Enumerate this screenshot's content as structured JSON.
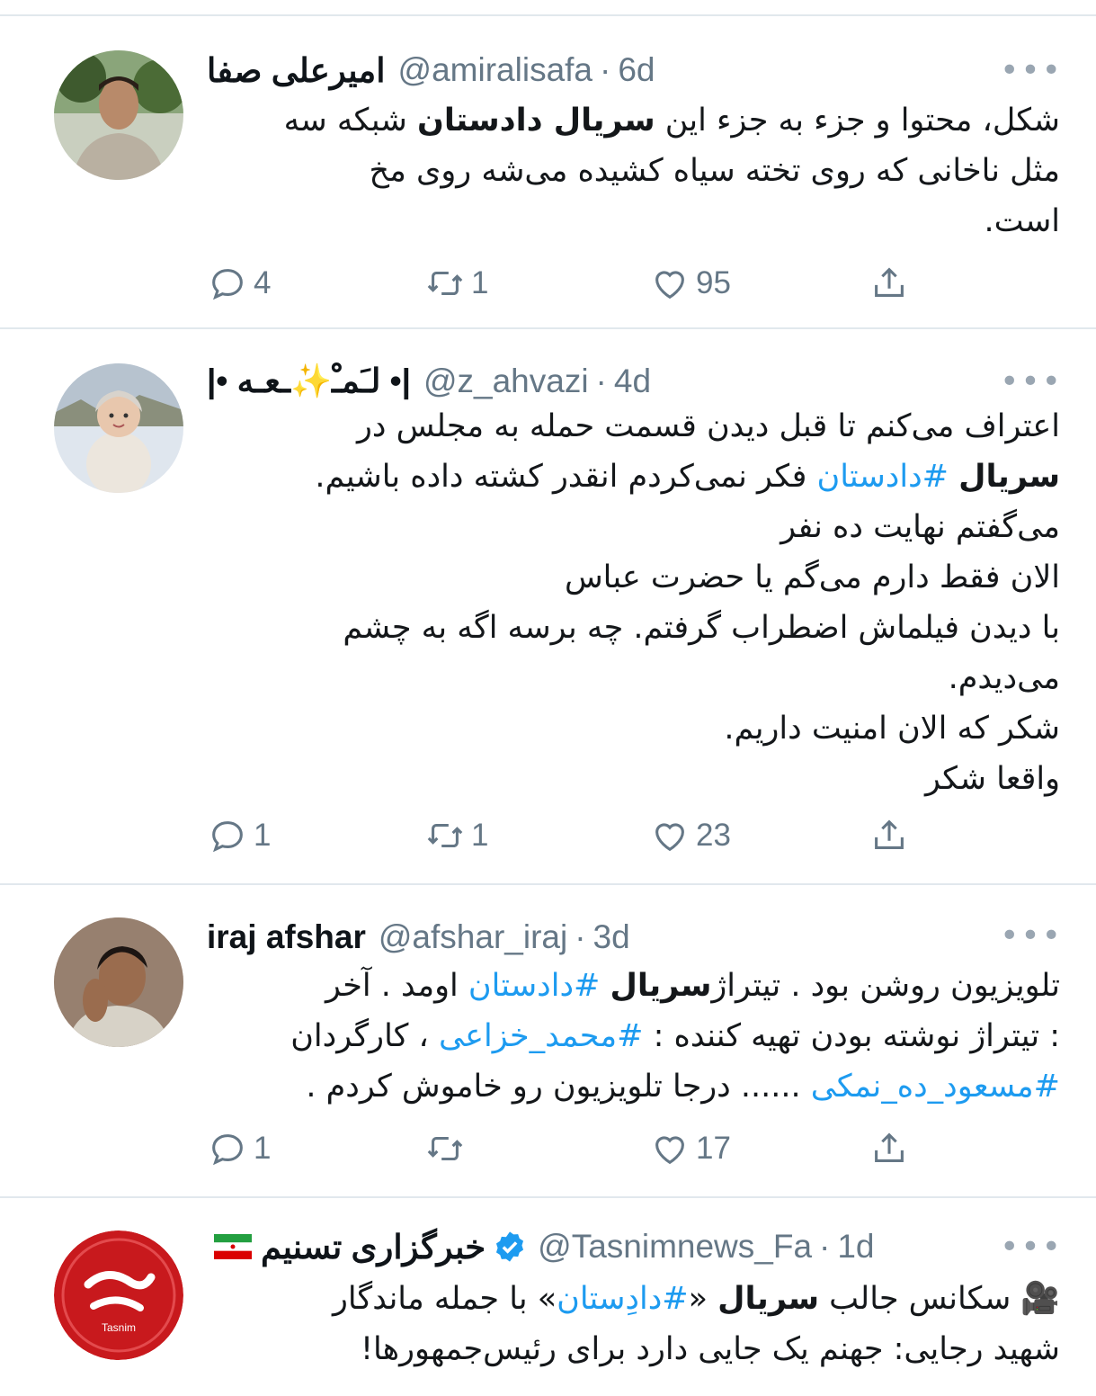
{
  "more_icon": "more-horizontal-icon",
  "colors": {
    "hashtag": "#1d9bf0",
    "meta": "#657786",
    "divider": "#e1e8ed",
    "verified": "#1d9bf0"
  },
  "tweets": [
    {
      "name": "امیرعلی صفا",
      "handle": "@amiralisafa",
      "time": "6d",
      "body_lines": [
        [
          "شکل، محتوا و جزء به جزء این ",
          {
            "b": "سریال دادستان"
          },
          " شبکه سه"
        ],
        [
          "مثل ناخانی که روی تخته سیاه کشیده می‌شه روی مخ"
        ],
        [
          "است."
        ]
      ],
      "replies": "4",
      "retweets": "1",
      "likes": "95"
    },
    {
      "name": "|• لـَمـْ✨ـعـه •|",
      "handle": "@z_ahvazi",
      "time": "4d",
      "body_lines": [
        [
          "اعتراف می‌کنم تا قبل دیدن قسمت حمله به مجلس در"
        ],
        [
          {
            "b": "سریال"
          },
          " ",
          {
            "h": "#دادستان"
          },
          " فکر نمی‌کردم انقدر کشته داده باشیم."
        ],
        [
          "می‌گفتم نهایت ده نفر"
        ],
        [
          "الان فقط دارم می‌گم یا حضرت عباس"
        ],
        [
          "با دیدن فیلماش اضطراب گرفتم. چه برسه اگه به چشم"
        ],
        [
          "می‌دیدم."
        ],
        [
          "شکر که الان امنیت داریم."
        ],
        [
          "واقعا شکر"
        ]
      ],
      "replies": "1",
      "retweets": "1",
      "likes": "23"
    },
    {
      "name": "iraj afshar",
      "handle": "@afshar_iraj",
      "time": "3d",
      "body_lines": [
        [
          "تلویزیون روشن بود . تیتراژ",
          {
            "b": "سریال"
          },
          " ",
          {
            "h": "#دادستان"
          },
          "  اومد . آخر"
        ],
        [
          ": تیتراژ نوشته بودن تهیه کننده : ",
          {
            "h": "#محمد_خزاعی"
          },
          " ، کارگردان"
        ],
        [
          {
            "h": "#مسعود_ده_نمکی"
          },
          " ...... درجا تلویزیون رو خاموش کردم ."
        ]
      ],
      "replies": "1",
      "retweets": "",
      "likes": "17"
    },
    {
      "name": "خبرگزاری تسنیم",
      "handle": "@Tasnimnews_Fa",
      "time": "1d",
      "avatar_text": "Tasnim",
      "body_lines": [
        [
          "🎥 سکانس جالب ",
          {
            "b": "سریال"
          },
          " «",
          {
            "h": "#دادِستان"
          },
          "» با جمله ماندگار"
        ],
        [
          "شهید رجایی: جهنم یک جایی دارد برای رئیس‌جمهورها!"
        ]
      ]
    }
  ]
}
